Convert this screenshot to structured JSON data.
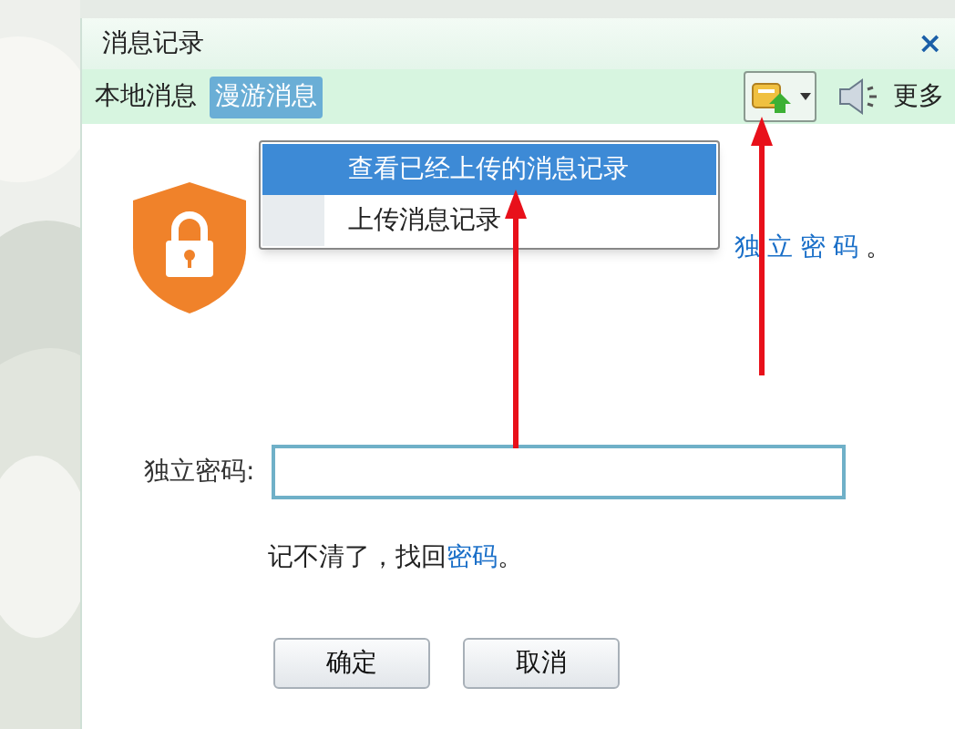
{
  "window": {
    "title": "消息记录",
    "close": "×"
  },
  "tabs": [
    {
      "label": "本地消息",
      "selected": false
    },
    {
      "label": "漫游消息",
      "selected": true
    }
  ],
  "toolbar": {
    "more": "更多"
  },
  "menu": {
    "items": [
      {
        "label": "查看已经上传的消息记录",
        "selected": true
      },
      {
        "label": "上传消息记录",
        "selected": false
      }
    ]
  },
  "notice": {
    "link": "独立密码",
    "end": "。"
  },
  "password": {
    "label": "独立密码:"
  },
  "recover": {
    "text": "记不清了，找回",
    "link": "密码",
    "end": "。"
  },
  "buttons": [
    "确定",
    "取消"
  ]
}
